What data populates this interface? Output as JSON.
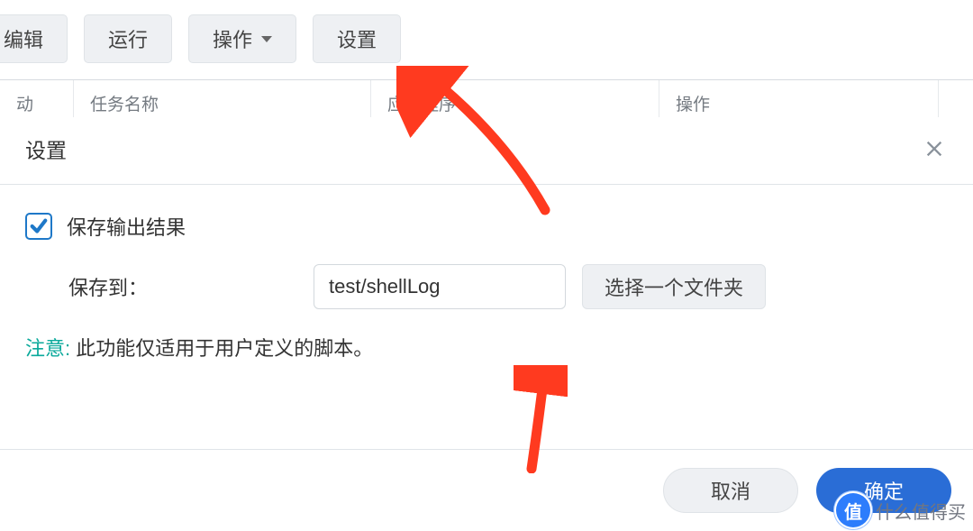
{
  "toolbar": {
    "edit": "编辑",
    "run": "运行",
    "action": "操作",
    "settings": "设置"
  },
  "bg_table": {
    "col1": "动",
    "col2": "任务名称",
    "col3": "应用程序",
    "col4": "操作",
    "col5": ""
  },
  "dialog": {
    "title": "设置",
    "save_output_label": "保存输出结果",
    "save_to_label": "保存到：",
    "save_to_value": "test/shellLog",
    "choose_folder_btn": "选择一个文件夹",
    "note_head": "注意:",
    "note_text": " 此功能仅适用于用户定义的脚本。",
    "cancel": "取消",
    "confirm": "确定"
  },
  "watermark": {
    "badge": "值",
    "text": "什么值得买"
  }
}
